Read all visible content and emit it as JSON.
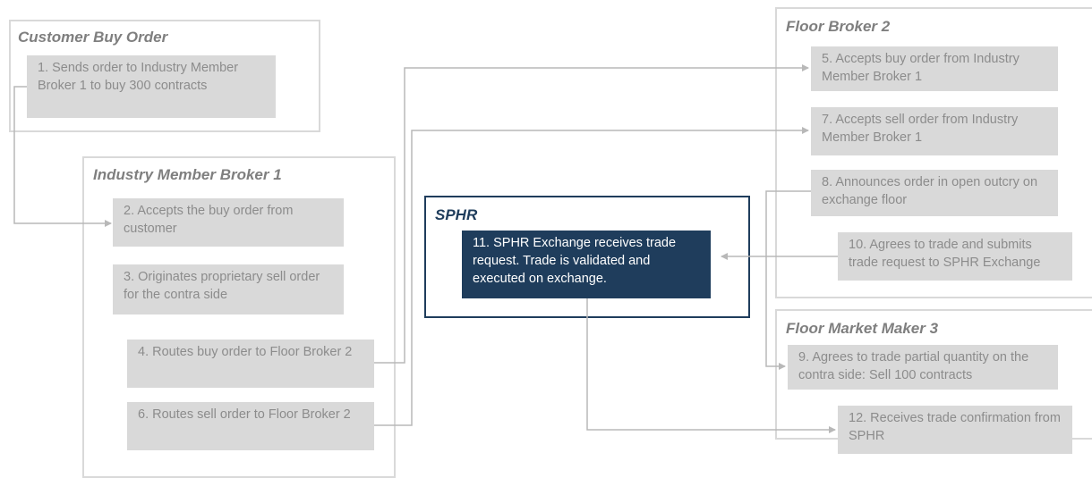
{
  "groups": {
    "customer": {
      "title": "Customer Buy Order"
    },
    "imb1": {
      "title": "Industry Member Broker 1"
    },
    "sphr": {
      "title": "SPHR"
    },
    "fb2": {
      "title": "Floor Broker 2"
    },
    "fmm3": {
      "title": "Floor Market Maker 3"
    }
  },
  "steps": {
    "s1": "1. Sends order to Industry Member Broker 1 to buy 300 contracts",
    "s2": "2. Accepts the buy order from customer",
    "s3": "3. Originates proprietary sell order for the contra side",
    "s4": "4. Routes buy order to Floor Broker 2",
    "s5": "5. Accepts buy order from Industry Member Broker 1",
    "s6": "6. Routes sell order to Floor Broker 2",
    "s7": "7. Accepts sell order from Industry Member Broker 1",
    "s8": "8. Announces order in open outcry on exchange floor",
    "s9": "9. Agrees to trade partial quantity on the contra side: Sell 100 contracts",
    "s10": "10. Agrees to trade and submits trade request to SPHR Exchange",
    "s11": "11. SPHR Exchange receives trade request. Trade is validated and executed on exchange.",
    "s12": "12. Receives trade confirmation from SPHR"
  },
  "colors": {
    "step_fill": "#d9d9d9",
    "step_text": "#8c8c8c",
    "highlight_fill": "#1f3d5c",
    "highlight_text": "#ffffff",
    "group_border": "#d9d9d9",
    "connector": "#b8b8b8"
  }
}
